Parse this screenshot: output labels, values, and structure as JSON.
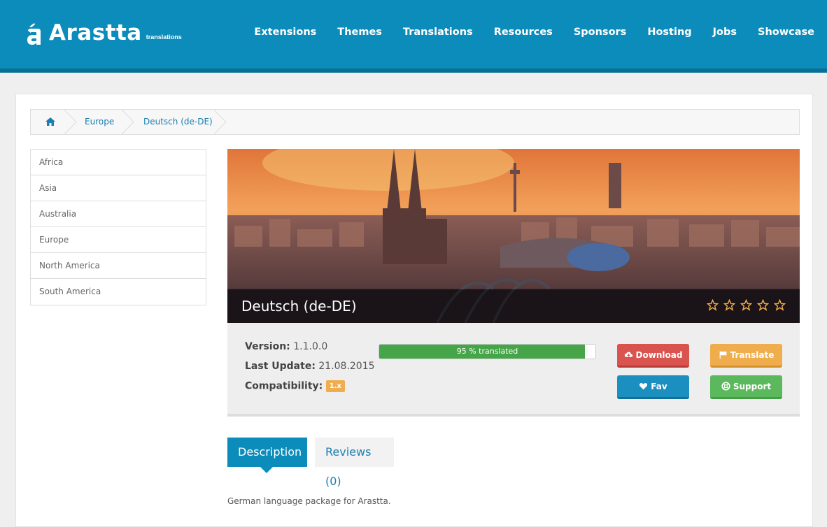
{
  "header": {
    "logo_text": "Arastta",
    "logo_sub": "translations",
    "nav": [
      "Extensions",
      "Themes",
      "Translations",
      "Resources",
      "Sponsors",
      "Hosting",
      "Jobs",
      "Showcase"
    ]
  },
  "breadcrumb": {
    "items": [
      "Europe",
      "Deutsch (de-DE)"
    ]
  },
  "sidebar": {
    "items": [
      "Africa",
      "Asia",
      "Australia",
      "Europe",
      "North America",
      "South America"
    ]
  },
  "hero": {
    "title": "Deutsch (de-DE)",
    "rating": 0,
    "max_rating": 5
  },
  "info": {
    "version_label": "Version:",
    "version_value": "1.1.0.0",
    "update_label": "Last Update:",
    "update_value": "21.08.2015",
    "compat_label": "Compatibility:",
    "compat_value": "1.x",
    "progress_percent": 95,
    "progress_text": "95 %  translated"
  },
  "buttons": {
    "download": "Download",
    "translate": "Translate",
    "fav": "Fav",
    "support": "Support"
  },
  "tabs": {
    "description": "Description",
    "reviews": "Reviews (0)"
  },
  "description": "German language package for Arastta.",
  "colors": {
    "brand": "#0b8cba",
    "progress": "#45a548",
    "download": "#d9534f",
    "translate": "#f0ad4e",
    "fav": "#1b8fc0",
    "support": "#5cb85c"
  }
}
